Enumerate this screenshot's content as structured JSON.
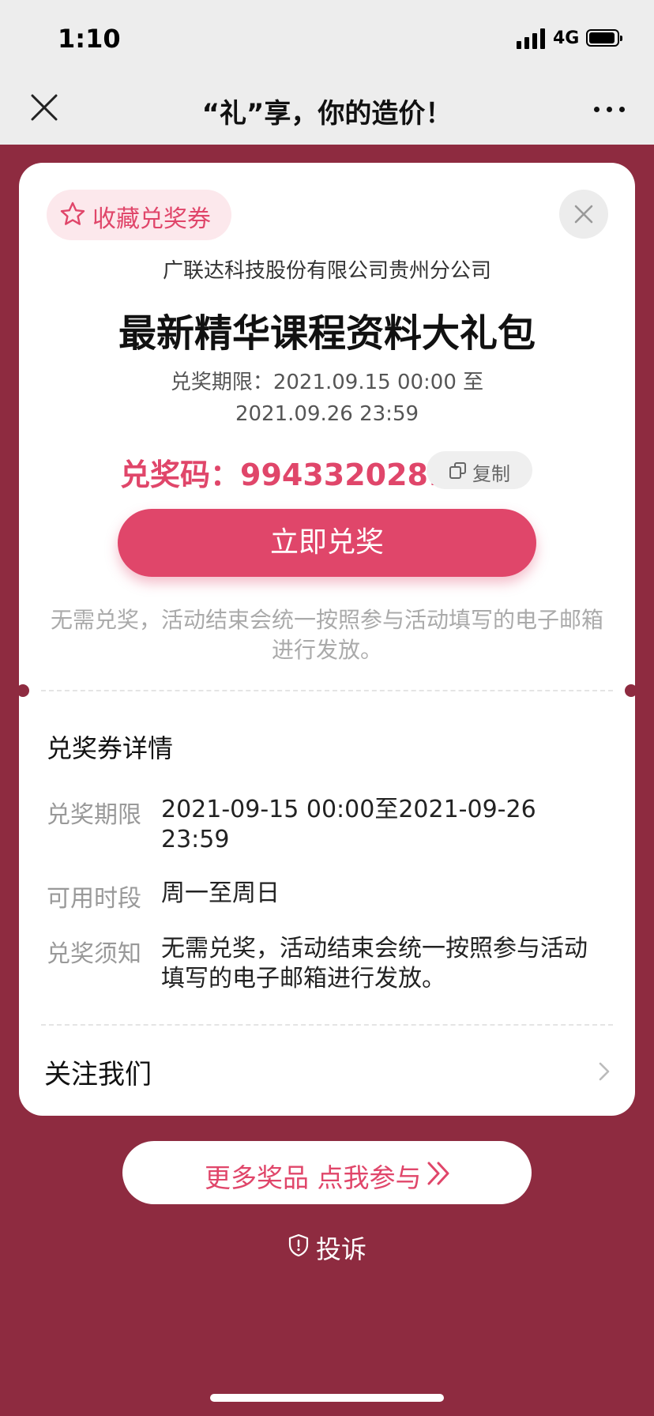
{
  "status_bar": {
    "time": "1:10",
    "network": "4G"
  },
  "nav": {
    "title": "“礼”享，你的造价！"
  },
  "card": {
    "favorite_label": "收藏兑奖券",
    "company": "广联达科技股份有限公司贵州分公司",
    "title": "最新精华课程资料大礼包",
    "period_line1": "兑奖期限：2021.09.15 00:00 至",
    "period_line2": "2021.09.26 23:59",
    "code_label": "兑奖码：",
    "code_value": "9943320281",
    "copy_label": "复制",
    "redeem_label": "立即兑奖",
    "note": "无需兑奖，活动结束会统一按照参与活动填写的电子邮箱进行发放。"
  },
  "details": {
    "title": "兑奖券详情",
    "rows": [
      {
        "label": "兑奖期限",
        "value": "2021-09-15 00:00至2021-09-26 23:59"
      },
      {
        "label": "可用时段",
        "value": "周一至周日"
      },
      {
        "label": "兑奖须知",
        "value": "无需兑奖，活动结束会统一按照参与活动填写的电子邮箱进行发放。"
      }
    ]
  },
  "follow_label": "关注我们",
  "more_button_label": "更多奖品  点我参与",
  "complain_label": "投诉",
  "colors": {
    "accent": "#e0466a",
    "background": "#8e2b40",
    "fav_bg": "#fce8ec"
  }
}
